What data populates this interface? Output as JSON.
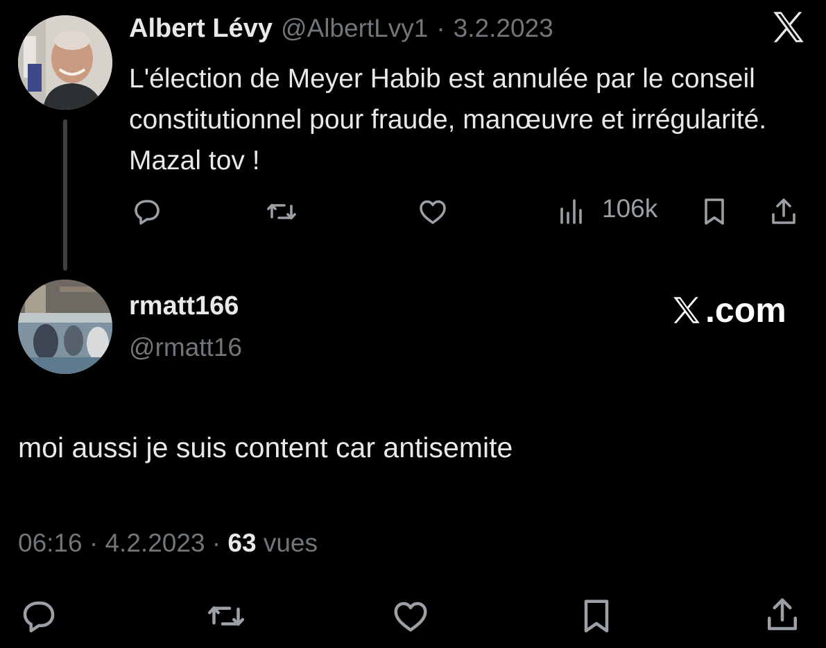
{
  "parent_tweet": {
    "author_name": "Albert Lévy",
    "handle": "@AlbertLvy1",
    "separator": "·",
    "date": "3.2.2023",
    "text": "L'élection de Meyer Habib est annulée par le conseil constitutionnel pour fraude, manœuvre et irrégularité. Mazal tov !",
    "views": "106k",
    "avatar": "profile-photo-man",
    "platform_icon": "x-logo-icon"
  },
  "reply": {
    "author_name": "rmatt166",
    "handle": "@rmatt16",
    "site_label": ".com",
    "text": "moi aussi je suis content car antisemite",
    "time": "06:16",
    "separator1": "·",
    "date": "4.2.2023",
    "separator2": "·",
    "views_count": "63",
    "views_label": "vues",
    "avatar": "profile-photo-group"
  },
  "actions": [
    "reply-icon",
    "retweet-icon",
    "like-icon",
    "views-icon",
    "bookmark-icon",
    "share-icon"
  ],
  "colors": {
    "background": "#000000",
    "text": "#e7e9ea",
    "muted": "#71767b",
    "icon": "#9aa0a6",
    "thread_line": "#3e4144"
  }
}
